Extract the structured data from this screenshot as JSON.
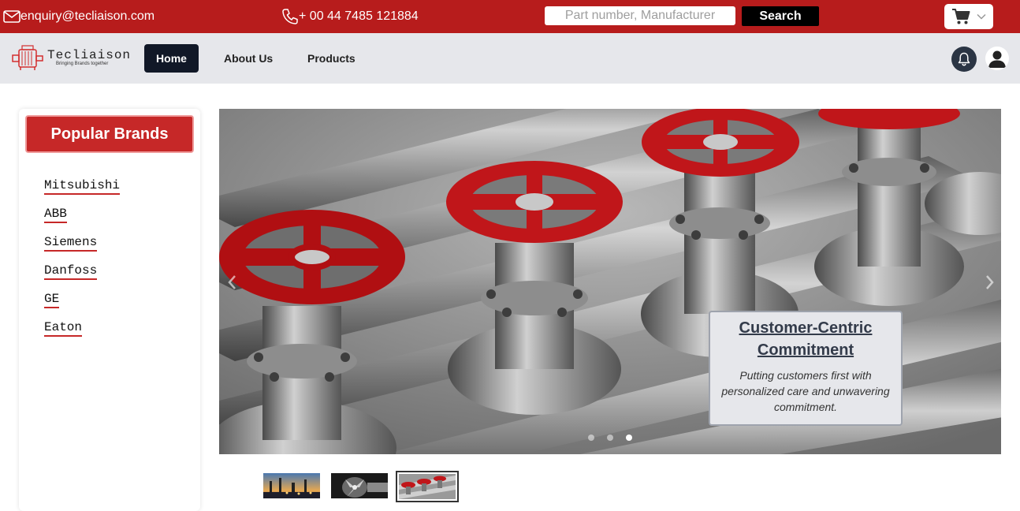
{
  "topbar": {
    "email": "enquiry@tecliaison.com",
    "phone": "+ 00 44 7485 121884",
    "search_placeholder": "Part number, Manufacturer",
    "search_button": "Search",
    "background_color": "#b71c1c"
  },
  "navbar": {
    "logo_text": "Tecliaison",
    "logo_tagline": "Bringing Brands together",
    "items": [
      {
        "label": "Home",
        "active": true
      },
      {
        "label": "About Us",
        "active": false
      },
      {
        "label": "Products",
        "active": false
      }
    ]
  },
  "sidebar": {
    "title": "Popular Brands",
    "brands": [
      "Mitsubishi",
      "ABB",
      "Siemens",
      "Danfoss",
      "GE",
      "Eaton"
    ]
  },
  "carousel": {
    "slide_count": 3,
    "active_slide": 3,
    "caption_title": "Customer-Centric Commitment",
    "caption_text": "Putting customers first with personalized care and unwavering commitment.",
    "thumbnails": [
      "industrial-plant-sunset",
      "turbine-engine",
      "red-valve-pipes"
    ]
  },
  "colors": {
    "accent_red": "#c62828",
    "nav_dark": "#111827",
    "nav_bg": "#e6e7eb"
  }
}
